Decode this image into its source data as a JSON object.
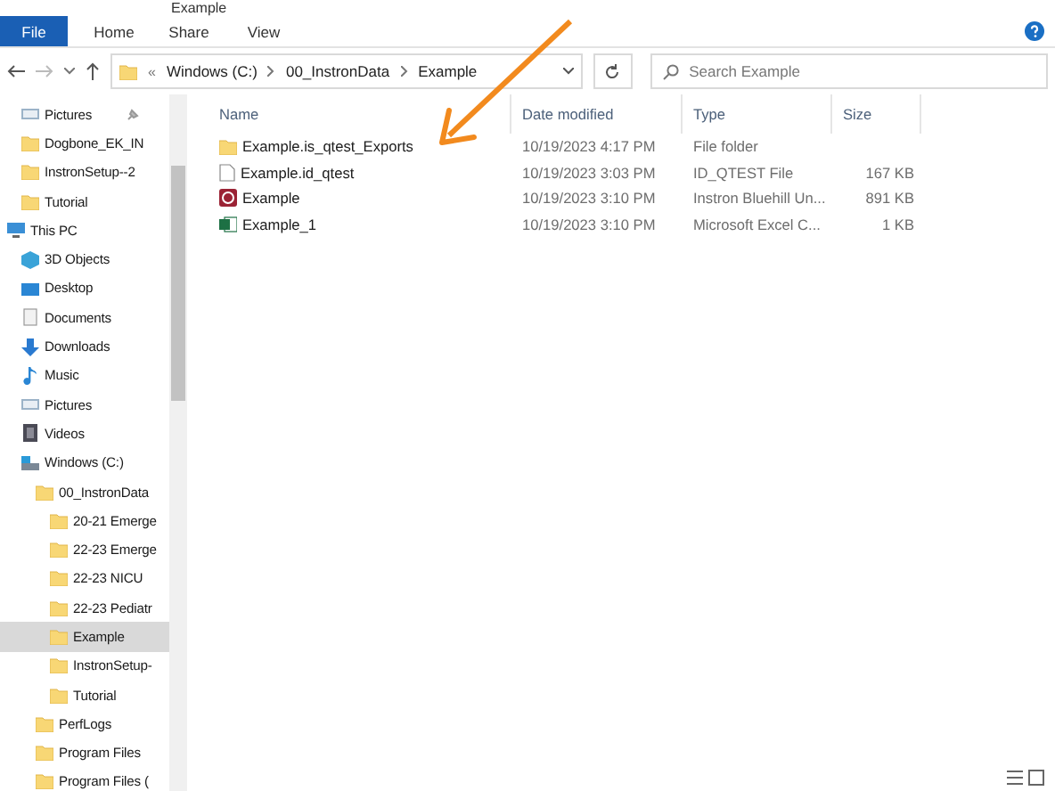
{
  "window": {
    "title": "Example"
  },
  "ribbon_tabs": [
    {
      "label": "File",
      "selected": true
    },
    {
      "label": "Home",
      "selected": false
    },
    {
      "label": "Share",
      "selected": false
    },
    {
      "label": "View",
      "selected": false
    }
  ],
  "address": {
    "overflow": "«",
    "path": [
      "Windows (C:)",
      "00_InstronData",
      "Example"
    ]
  },
  "search": {
    "placeholder": "Search Example"
  },
  "nav": [
    {
      "label": "Pictures",
      "kind": "pictures",
      "pinned": true,
      "selected": false
    },
    {
      "label": "Dogbone_EK_IN",
      "kind": "folder",
      "pinned": false,
      "selected": false
    },
    {
      "label": "InstronSetup--2",
      "kind": "folder",
      "pinned": false,
      "selected": false
    },
    {
      "label": "Tutorial",
      "kind": "folder",
      "pinned": false,
      "selected": false
    },
    {
      "label": "This PC",
      "kind": "pc",
      "pinned": false,
      "selected": false,
      "children": [
        {
          "label": "3D Objects",
          "kind": "cube",
          "pinned": false,
          "selected": false
        },
        {
          "label": "Desktop",
          "kind": "desktop",
          "pinned": false,
          "selected": false
        },
        {
          "label": "Documents",
          "kind": "documents",
          "pinned": false,
          "selected": false
        },
        {
          "label": "Downloads",
          "kind": "downloads",
          "pinned": false,
          "selected": false
        },
        {
          "label": "Music",
          "kind": "music",
          "pinned": false,
          "selected": false
        },
        {
          "label": "Pictures",
          "kind": "pictures",
          "pinned": false,
          "selected": false
        },
        {
          "label": "Videos",
          "kind": "videos",
          "pinned": false,
          "selected": false
        },
        {
          "label": "Windows (C:)",
          "kind": "drive",
          "pinned": false,
          "selected": false,
          "children": [
            {
              "label": "00_InstronData",
              "kind": "folder",
              "pinned": false,
              "selected": false,
              "children": [
                {
                  "label": "20-21 Emerge",
                  "kind": "folder",
                  "pinned": false,
                  "selected": false
                },
                {
                  "label": "22-23 Emerge",
                  "kind": "folder",
                  "pinned": false,
                  "selected": false
                },
                {
                  "label": "22-23 NICU",
                  "kind": "folder",
                  "pinned": false,
                  "selected": false
                },
                {
                  "label": "22-23 Pediatr",
                  "kind": "folder",
                  "pinned": false,
                  "selected": false
                },
                {
                  "label": "Example",
                  "kind": "folder",
                  "pinned": false,
                  "selected": true
                },
                {
                  "label": "InstronSetup-",
                  "kind": "folder",
                  "pinned": false,
                  "selected": false
                },
                {
                  "label": "Tutorial",
                  "kind": "folder",
                  "pinned": false,
                  "selected": false
                }
              ]
            },
            {
              "label": "PerfLogs",
              "kind": "folder",
              "pinned": false,
              "selected": false
            },
            {
              "label": "Program Files",
              "kind": "folder",
              "pinned": false,
              "selected": false
            },
            {
              "label": "Program Files (",
              "kind": "folder",
              "pinned": false,
              "selected": false
            }
          ]
        }
      ]
    }
  ],
  "columns": [
    "Name",
    "Date modified",
    "Type",
    "Size"
  ],
  "files": [
    {
      "name": "Example.is_qtest_Exports",
      "kind": "folder",
      "date": "10/19/2023 4:17 PM",
      "type": "File folder"
    },
    {
      "name": "Example.id_qtest",
      "kind": "file",
      "date": "10/19/2023 3:03 PM",
      "type": "ID_QTEST File",
      "size": "167 KB"
    },
    {
      "name": "Example",
      "kind": "instron",
      "date": "10/19/2023 3:10 PM",
      "type": "Instron Bluehill Un...",
      "size": "891 KB"
    },
    {
      "name": "Example_1",
      "kind": "excel",
      "date": "10/19/2023 3:10 PM",
      "type": "Microsoft Excel C...",
      "size": "1 KB"
    }
  ]
}
